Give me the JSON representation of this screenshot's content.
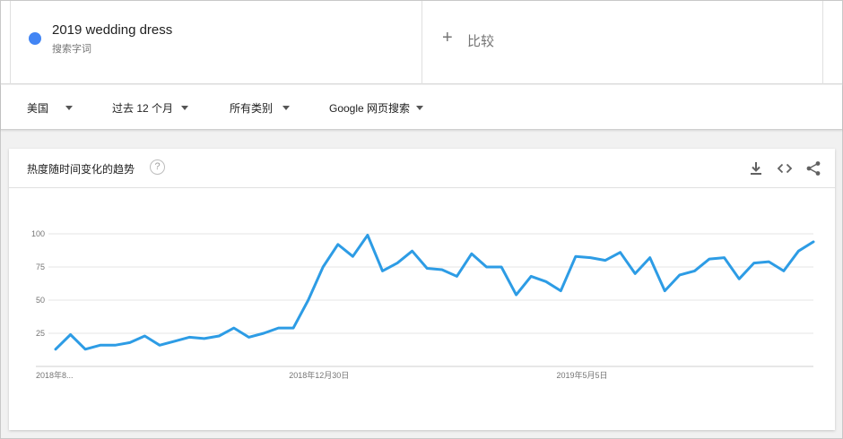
{
  "term": {
    "name": "2019 wedding dress",
    "sublabel": "搜索字词",
    "color": "#4285f4"
  },
  "compare": {
    "plus": "+",
    "label": "比较"
  },
  "filters": [
    {
      "label": "美国"
    },
    {
      "label": "过去 12 个月"
    },
    {
      "label": "所有类别"
    },
    {
      "label": "Google 网页搜索"
    }
  ],
  "chart_card": {
    "title": "热度随时间变化的趋势",
    "help": "?",
    "icons": [
      "download-icon",
      "embed-icon",
      "share-icon"
    ]
  },
  "chart_data": {
    "type": "line",
    "title": "热度随时间变化的趋势",
    "xlabel": "",
    "ylabel": "",
    "ylim": [
      0,
      100
    ],
    "yticks": [
      "100",
      "75",
      "50",
      "25"
    ],
    "ytick_values": [
      100,
      75,
      50,
      25
    ],
    "xticks": [
      "2018年8...",
      "2018年12月30日",
      "2019年5月5日"
    ],
    "xtick_indices": [
      0,
      18,
      36
    ],
    "grid": true,
    "series_color": "#2d9ce5",
    "series": [
      {
        "values": [
          13,
          24,
          13,
          16,
          16,
          18,
          23,
          16,
          19,
          22,
          21,
          23,
          29,
          22,
          25,
          29,
          29,
          50,
          75,
          92,
          83,
          99,
          72,
          78,
          87,
          74,
          73,
          68,
          85,
          75,
          75,
          54,
          68,
          64,
          57,
          83,
          82,
          80,
          86,
          70,
          82,
          57,
          69,
          72,
          81,
          82,
          66,
          78,
          79,
          72,
          87,
          94
        ]
      }
    ]
  }
}
